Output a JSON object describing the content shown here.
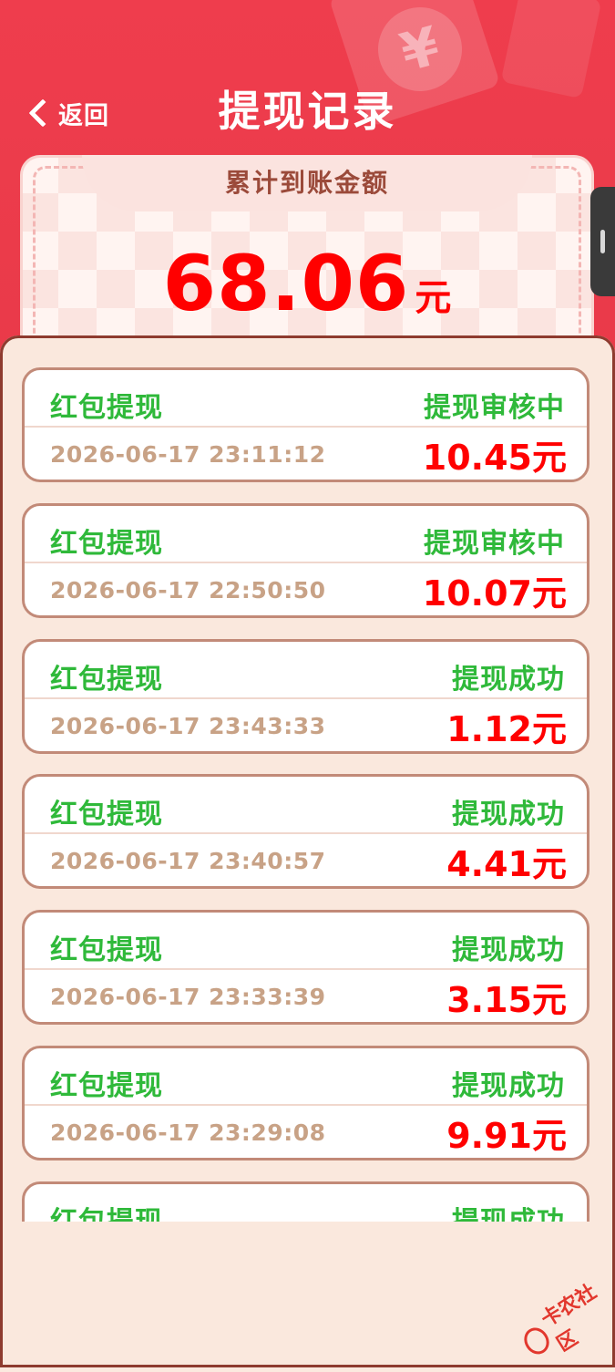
{
  "header": {
    "back_label": "返回",
    "title": "提现记录"
  },
  "summary": {
    "label": "累计到账金额",
    "amount": "68.06",
    "unit": "元"
  },
  "records": [
    {
      "type": "红包提现",
      "status": "提现审核中",
      "time": "2026-06-17 23:11:12",
      "amount": "10.45元"
    },
    {
      "type": "红包提现",
      "status": "提现审核中",
      "time": "2026-06-17 22:50:50",
      "amount": "10.07元"
    },
    {
      "type": "红包提现",
      "status": "提现成功",
      "time": "2026-06-17 23:43:33",
      "amount": "1.12元"
    },
    {
      "type": "红包提现",
      "status": "提现成功",
      "time": "2026-06-17 23:40:57",
      "amount": "4.41元"
    },
    {
      "type": "红包提现",
      "status": "提现成功",
      "time": "2026-06-17 23:33:39",
      "amount": "3.15元"
    },
    {
      "type": "红包提现",
      "status": "提现成功",
      "time": "2026-06-17 23:29:08",
      "amount": "9.91元"
    },
    {
      "type": "红包提现",
      "status": "提现成功",
      "time": "",
      "amount": ""
    }
  ],
  "watermark": "卡农社区",
  "colors": {
    "header_red": "#ef3d4d",
    "amount_red": "#ff0000",
    "status_green": "#2fb93a",
    "time_tan": "#c8a286"
  }
}
